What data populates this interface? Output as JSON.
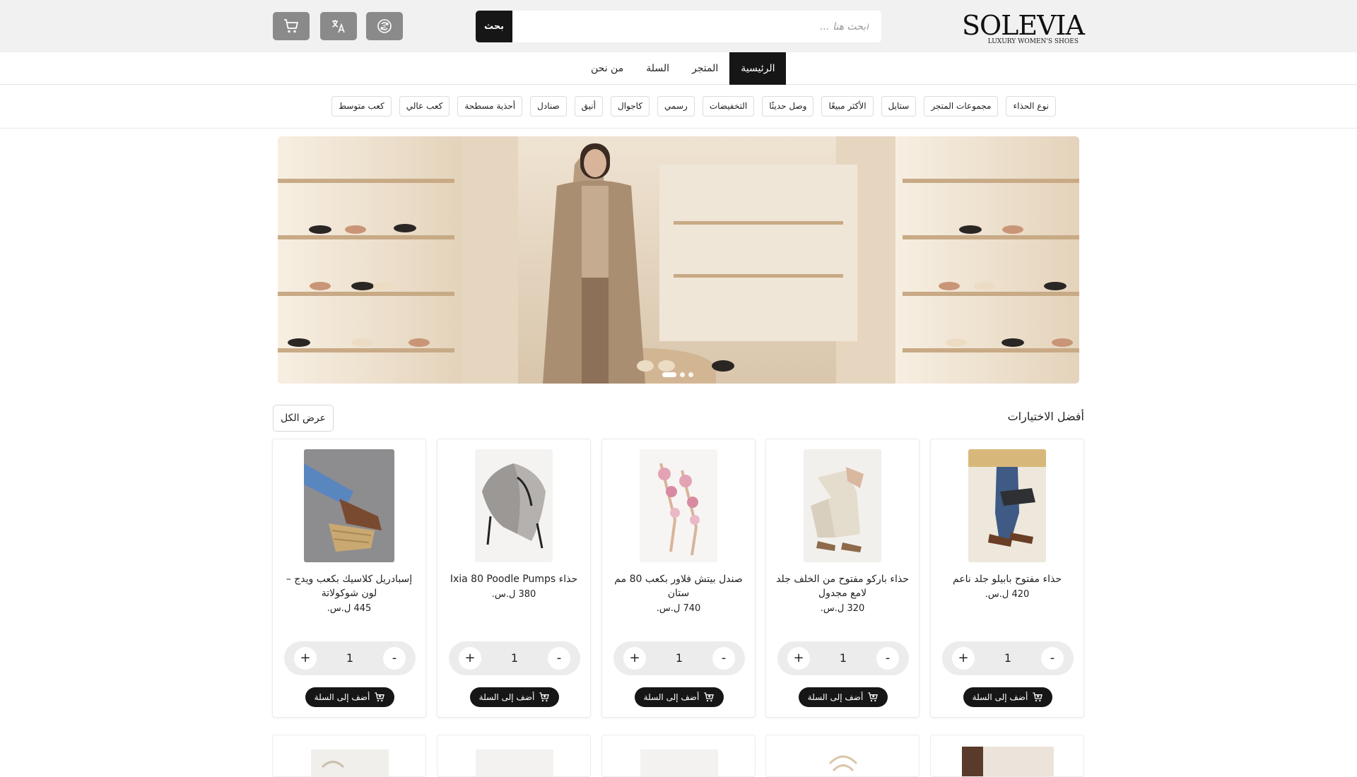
{
  "header": {
    "logo_text": "SOLEVIA",
    "logo_tagline": "LUXURY WOMEN'S SHOES",
    "search_placeholder": "ابحث هنا ...",
    "search_button": "بحث",
    "icons": [
      "cart-icon",
      "translate-icon",
      "currency-icon"
    ]
  },
  "nav": {
    "items": [
      {
        "label": "الرئيسية",
        "active": true
      },
      {
        "label": "المتجر"
      },
      {
        "label": "السلة"
      },
      {
        "label": "من نحن"
      }
    ]
  },
  "filters": [
    "نوع الحذاء",
    "مجموعات المتجر",
    "ستايل",
    "الأكثر مبيعًا",
    "وصل حديثًا",
    "التخفيضات",
    "رسمي",
    "كاجوال",
    "أنيق",
    "صنادل",
    "أحذية مسطحة",
    "كعب عالي",
    "كعب متوسط"
  ],
  "hero": {
    "slides": 3,
    "active_slide": 1
  },
  "section": {
    "title": "أفضل الاختيارات",
    "view_all": "عرض الكل"
  },
  "products": [
    {
      "title": "حذاء مفتوح بابيلو جلد ناعم",
      "price": "420 ل.س.",
      "qty": "1",
      "add_label": "أضف إلى السلة"
    },
    {
      "title": "حذاء باركو مفتوح من الخلف جلد لامع مجدول",
      "price": "320 ل.س.",
      "qty": "1",
      "add_label": "أضف إلى السلة"
    },
    {
      "title": "صندل بيتش فلاور بكعب 80 مم ستان",
      "price": "740 ل.س.",
      "qty": "1",
      "add_label": "أضف إلى السلة"
    },
    {
      "title": "حذاء Ixia 80 Poodle Pumps",
      "price": "380 ل.س.",
      "qty": "1",
      "add_label": "أضف إلى السلة"
    },
    {
      "title": "إسبادريل كلاسيك بكعب ويدج – لون شوكولاتة",
      "price": "445 ل.س.",
      "qty": "1",
      "add_label": "أضف إلى السلة"
    }
  ],
  "qty_controls": {
    "minus": "-",
    "plus": "+"
  },
  "colors": {
    "primary": "#161616",
    "header_bg": "#f1f1f1",
    "icon_btn": "#8a8a8a"
  }
}
